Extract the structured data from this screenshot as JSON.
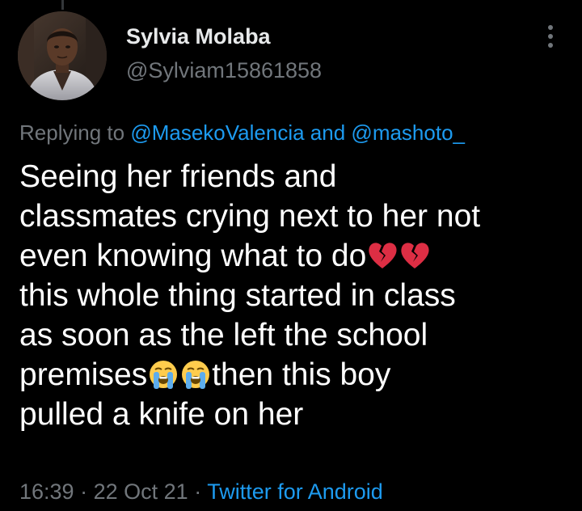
{
  "colors": {
    "background": "#000000",
    "primary_text": "#ffffff",
    "secondary_text": "#71767b",
    "link": "#1d9bf0"
  },
  "author": {
    "display_name": "Sylvia Molaba",
    "handle": "@Sylviam15861858",
    "avatar_icon": "profile-photo"
  },
  "more_menu": {
    "icon": "vertical-ellipsis-icon"
  },
  "reply_context": {
    "prefix": "Replying to",
    "mention_1": "@MasekoValencia",
    "conjunction": "and",
    "mention_2": "@mashoto_"
  },
  "tweet": {
    "lines": [
      "Seeing her friends and",
      "classmates crying next to her not",
      "even knowing what to do",
      "this whole thing started in class",
      "as soon as the left the school",
      "premises",
      "then this boy",
      "pulled a knife on her"
    ],
    "emojis": {
      "broken_heart": "💔",
      "loudly_crying": "😭"
    }
  },
  "meta": {
    "time": "16:39",
    "separator": "·",
    "date": "22 Oct 21",
    "source": "Twitter for Android"
  }
}
